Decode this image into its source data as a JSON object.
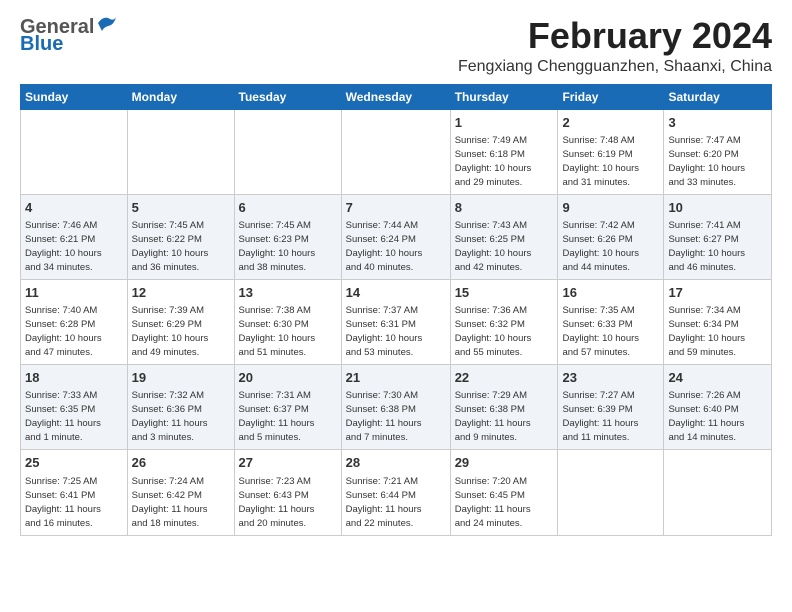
{
  "header": {
    "logo_general": "General",
    "logo_blue": "Blue",
    "month": "February 2024",
    "location": "Fengxiang Chengguanzhen, Shaanxi, China"
  },
  "days_of_week": [
    "Sunday",
    "Monday",
    "Tuesday",
    "Wednesday",
    "Thursday",
    "Friday",
    "Saturday"
  ],
  "weeks": [
    [
      {
        "day": "",
        "info": ""
      },
      {
        "day": "",
        "info": ""
      },
      {
        "day": "",
        "info": ""
      },
      {
        "day": "",
        "info": ""
      },
      {
        "day": "1",
        "info": "Sunrise: 7:49 AM\nSunset: 6:18 PM\nDaylight: 10 hours\nand 29 minutes."
      },
      {
        "day": "2",
        "info": "Sunrise: 7:48 AM\nSunset: 6:19 PM\nDaylight: 10 hours\nand 31 minutes."
      },
      {
        "day": "3",
        "info": "Sunrise: 7:47 AM\nSunset: 6:20 PM\nDaylight: 10 hours\nand 33 minutes."
      }
    ],
    [
      {
        "day": "4",
        "info": "Sunrise: 7:46 AM\nSunset: 6:21 PM\nDaylight: 10 hours\nand 34 minutes."
      },
      {
        "day": "5",
        "info": "Sunrise: 7:45 AM\nSunset: 6:22 PM\nDaylight: 10 hours\nand 36 minutes."
      },
      {
        "day": "6",
        "info": "Sunrise: 7:45 AM\nSunset: 6:23 PM\nDaylight: 10 hours\nand 38 minutes."
      },
      {
        "day": "7",
        "info": "Sunrise: 7:44 AM\nSunset: 6:24 PM\nDaylight: 10 hours\nand 40 minutes."
      },
      {
        "day": "8",
        "info": "Sunrise: 7:43 AM\nSunset: 6:25 PM\nDaylight: 10 hours\nand 42 minutes."
      },
      {
        "day": "9",
        "info": "Sunrise: 7:42 AM\nSunset: 6:26 PM\nDaylight: 10 hours\nand 44 minutes."
      },
      {
        "day": "10",
        "info": "Sunrise: 7:41 AM\nSunset: 6:27 PM\nDaylight: 10 hours\nand 46 minutes."
      }
    ],
    [
      {
        "day": "11",
        "info": "Sunrise: 7:40 AM\nSunset: 6:28 PM\nDaylight: 10 hours\nand 47 minutes."
      },
      {
        "day": "12",
        "info": "Sunrise: 7:39 AM\nSunset: 6:29 PM\nDaylight: 10 hours\nand 49 minutes."
      },
      {
        "day": "13",
        "info": "Sunrise: 7:38 AM\nSunset: 6:30 PM\nDaylight: 10 hours\nand 51 minutes."
      },
      {
        "day": "14",
        "info": "Sunrise: 7:37 AM\nSunset: 6:31 PM\nDaylight: 10 hours\nand 53 minutes."
      },
      {
        "day": "15",
        "info": "Sunrise: 7:36 AM\nSunset: 6:32 PM\nDaylight: 10 hours\nand 55 minutes."
      },
      {
        "day": "16",
        "info": "Sunrise: 7:35 AM\nSunset: 6:33 PM\nDaylight: 10 hours\nand 57 minutes."
      },
      {
        "day": "17",
        "info": "Sunrise: 7:34 AM\nSunset: 6:34 PM\nDaylight: 10 hours\nand 59 minutes."
      }
    ],
    [
      {
        "day": "18",
        "info": "Sunrise: 7:33 AM\nSunset: 6:35 PM\nDaylight: 11 hours\nand 1 minute."
      },
      {
        "day": "19",
        "info": "Sunrise: 7:32 AM\nSunset: 6:36 PM\nDaylight: 11 hours\nand 3 minutes."
      },
      {
        "day": "20",
        "info": "Sunrise: 7:31 AM\nSunset: 6:37 PM\nDaylight: 11 hours\nand 5 minutes."
      },
      {
        "day": "21",
        "info": "Sunrise: 7:30 AM\nSunset: 6:38 PM\nDaylight: 11 hours\nand 7 minutes."
      },
      {
        "day": "22",
        "info": "Sunrise: 7:29 AM\nSunset: 6:38 PM\nDaylight: 11 hours\nand 9 minutes."
      },
      {
        "day": "23",
        "info": "Sunrise: 7:27 AM\nSunset: 6:39 PM\nDaylight: 11 hours\nand 11 minutes."
      },
      {
        "day": "24",
        "info": "Sunrise: 7:26 AM\nSunset: 6:40 PM\nDaylight: 11 hours\nand 14 minutes."
      }
    ],
    [
      {
        "day": "25",
        "info": "Sunrise: 7:25 AM\nSunset: 6:41 PM\nDaylight: 11 hours\nand 16 minutes."
      },
      {
        "day": "26",
        "info": "Sunrise: 7:24 AM\nSunset: 6:42 PM\nDaylight: 11 hours\nand 18 minutes."
      },
      {
        "day": "27",
        "info": "Sunrise: 7:23 AM\nSunset: 6:43 PM\nDaylight: 11 hours\nand 20 minutes."
      },
      {
        "day": "28",
        "info": "Sunrise: 7:21 AM\nSunset: 6:44 PM\nDaylight: 11 hours\nand 22 minutes."
      },
      {
        "day": "29",
        "info": "Sunrise: 7:20 AM\nSunset: 6:45 PM\nDaylight: 11 hours\nand 24 minutes."
      },
      {
        "day": "",
        "info": ""
      },
      {
        "day": "",
        "info": ""
      }
    ]
  ]
}
